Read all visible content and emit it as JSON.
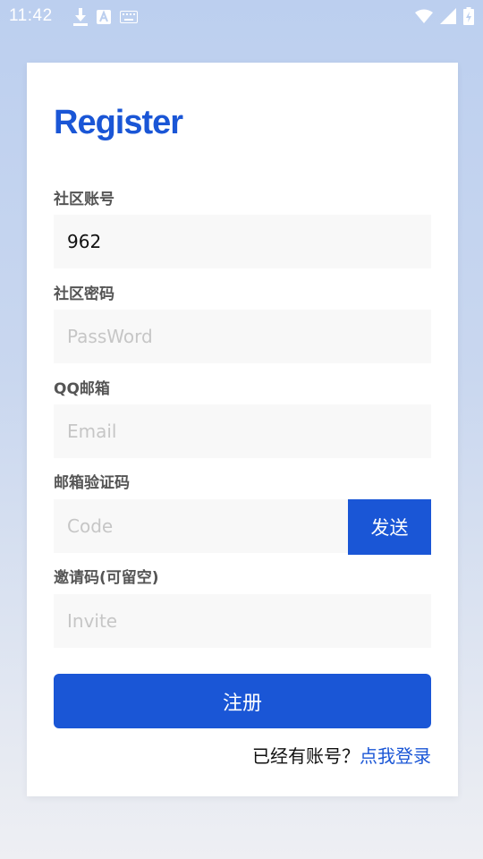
{
  "status_bar": {
    "time": "11:42",
    "icons_left": [
      "download-icon",
      "a-notification-icon",
      "keyboard-icon"
    ],
    "icons_right": [
      "wifi-icon",
      "signal-icon",
      "battery-charging-icon"
    ]
  },
  "form": {
    "title": "Register",
    "account": {
      "label": "社区账号",
      "value": "962"
    },
    "password": {
      "label": "社区密码",
      "placeholder": "PassWord"
    },
    "email": {
      "label": "QQ邮箱",
      "placeholder": "Email"
    },
    "code": {
      "label": "邮箱验证码",
      "placeholder": "Code",
      "send_label": "发送"
    },
    "invite": {
      "label": "邀请码(可留空)",
      "placeholder": "Invite"
    },
    "register_label": "注册",
    "login_prompt": "已经有账号？",
    "login_link": "点我登录"
  },
  "colors": {
    "accent": "#1a56d6",
    "input_bg": "#f8f8f8",
    "label": "#555555",
    "placeholder": "#c6c6c6"
  }
}
